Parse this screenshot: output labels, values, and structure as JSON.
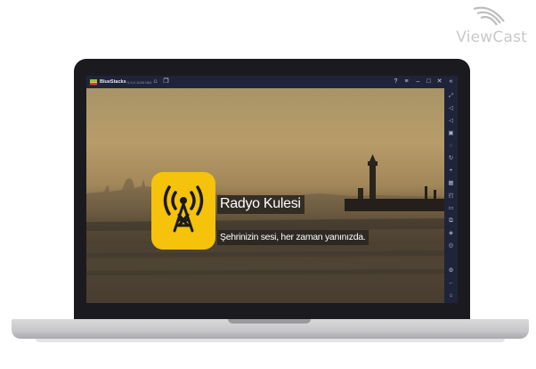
{
  "watermark": {
    "text": "ViewCast"
  },
  "emulator": {
    "title": "BlueStacks",
    "version": "5.9.0.1028 N64",
    "titlebar_icons": [
      "home-icon",
      "multi-instance-icon",
      "help-icon",
      "menu-icon",
      "minimize-icon",
      "maximize-icon",
      "close-icon"
    ],
    "sidebar_icons": [
      "fullscreen-icon",
      "volume-up-icon",
      "volume-down-icon",
      "media-icon",
      "eco-icon",
      "rotate-icon",
      "gamepad-icon",
      "apk-icon",
      "screenshot-icon",
      "folder-icon",
      "copy-icon",
      "layers-icon",
      "macro-icon",
      "settings-icon",
      "back-icon",
      "home-icon",
      "recents-icon"
    ]
  },
  "splash": {
    "app_name": "Radyo Kulesi",
    "tagline": "Şehrinizin sesi, her zaman yanınızda.",
    "icon": "radio-tower-icon",
    "icon_color": "#f5c20c"
  }
}
